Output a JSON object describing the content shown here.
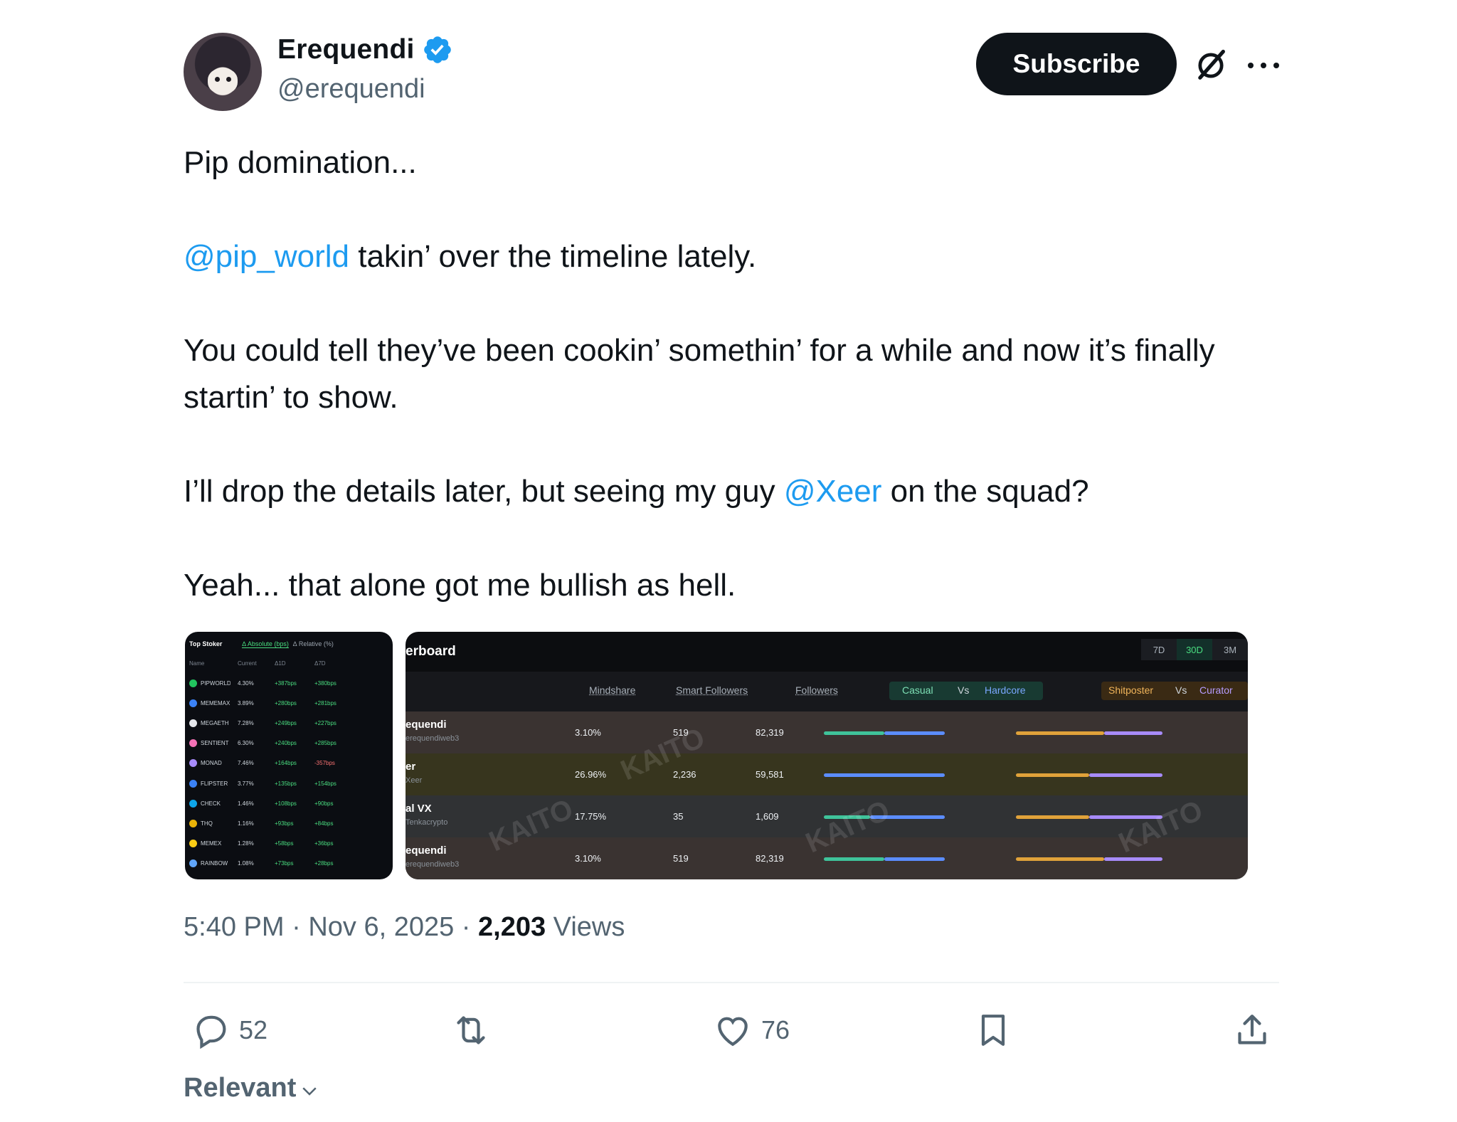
{
  "author": {
    "display_name": "Erequendi",
    "handle": "@erequendi",
    "verified_icon": "verified-badge-icon"
  },
  "header": {
    "subscribe_label": "Subscribe",
    "grok_icon": "grok-icon",
    "more_icon": "more-icon"
  },
  "tweet": {
    "paragraphs": {
      "p1": "Pip domination...",
      "p2_mention": "@pip_world",
      "p2_rest": " takin’ over the timeline lately.",
      "p3": "You could tell they’ve been cookin’ somethin’ for a while and now it’s finally startin’ to show.",
      "p4_start": "I’ll drop the details later, but seeing my guy ",
      "p4_mention": "@Xeer",
      "p4_end": " on the squad?",
      "p5": "Yeah... that alone got me bullish as hell."
    },
    "mention_color": "#1d9bf0"
  },
  "image1": {
    "title": "Top Stoker",
    "tab_active": "∆ Absolute (bps)",
    "tab_other": "∆ Relative (%)",
    "columns": [
      "Name",
      "Current",
      "Δ1D",
      "Δ7D"
    ],
    "rows": [
      {
        "name": "PIPWORLD",
        "current": "4.30%",
        "d1": "+387bps",
        "d7": "+380bps",
        "color": "#22c55e"
      },
      {
        "name": "MEMEMAX",
        "current": "3.89%",
        "d1": "+280bps",
        "d7": "+281bps",
        "color": "#3b82f6"
      },
      {
        "name": "MEGAETH",
        "current": "7.28%",
        "d1": "+249bps",
        "d7": "+227bps",
        "color": "#e5e7eb"
      },
      {
        "name": "SENTIENT",
        "current": "6.30%",
        "d1": "+240bps",
        "d7": "+285bps",
        "color": "#f472b6"
      },
      {
        "name": "MONAD",
        "current": "7.46%",
        "d1": "+164bps",
        "d7": "-357bps",
        "color": "#a78bfa"
      },
      {
        "name": "FLIPSTER",
        "current": "3.77%",
        "d1": "+135bps",
        "d7": "+154bps",
        "color": "#3b82f6"
      },
      {
        "name": "CHECK",
        "current": "1.46%",
        "d1": "+108bps",
        "d7": "+90bps",
        "color": "#0ea5e9"
      },
      {
        "name": "THQ",
        "current": "1.16%",
        "d1": "+93bps",
        "d7": "+84bps",
        "color": "#eab308"
      },
      {
        "name": "MEMEX",
        "current": "1.28%",
        "d1": "+58bps",
        "d7": "+36bps",
        "color": "#facc15"
      },
      {
        "name": "RAINBOW",
        "current": "1.08%",
        "d1": "+73bps",
        "d7": "+28bps",
        "color": "#60a5fa"
      }
    ]
  },
  "image2": {
    "title": "erboard",
    "tabs": [
      "7D",
      "30D",
      "3M"
    ],
    "columns": {
      "mindshare": "Mindshare",
      "smart_followers": "Smart Followers",
      "followers": "Followers",
      "casual": "Casual",
      "vs1": "Vs",
      "hardcore": "Hardcore",
      "shitposter": "Shitposter",
      "vs2": "Vs",
      "curator": "Curator"
    },
    "watermark": "KAITO",
    "rows": [
      {
        "user": "equendi",
        "sub": "erequendiweb3",
        "mindshare": "3.10%",
        "smart": "519",
        "followers": "82,319",
        "casual_pct": 0.5,
        "ship_pct": 0.6,
        "bg": "#3a3331"
      },
      {
        "user": "er",
        "sub": "Xeer",
        "mindshare": "26.96%",
        "smart": "2,236",
        "followers": "59,581",
        "casual_pct": 0.0,
        "ship_pct": 0.5,
        "bg": "#37351e"
      },
      {
        "user": "al VX",
        "sub": "Tenkacrypto",
        "mindshare": "17.75%",
        "smart": "35",
        "followers": "1,609",
        "casual_pct": 0.38,
        "ship_pct": 0.5,
        "bg": "#303234"
      },
      {
        "user": "equendi",
        "sub": "erequendiweb3",
        "mindshare": "3.10%",
        "smart": "519",
        "followers": "82,319",
        "casual_pct": 0.5,
        "ship_pct": 0.6,
        "bg": "#3a3331"
      }
    ]
  },
  "meta": {
    "time": "5:40 PM",
    "sep1": " · ",
    "date": "Nov 6, 2025",
    "sep2": " · ",
    "views_count": "2,203",
    "views_label": " Views"
  },
  "actions": {
    "reply_count": "52",
    "like_count": "76"
  },
  "sort": {
    "label": "Relevant"
  }
}
